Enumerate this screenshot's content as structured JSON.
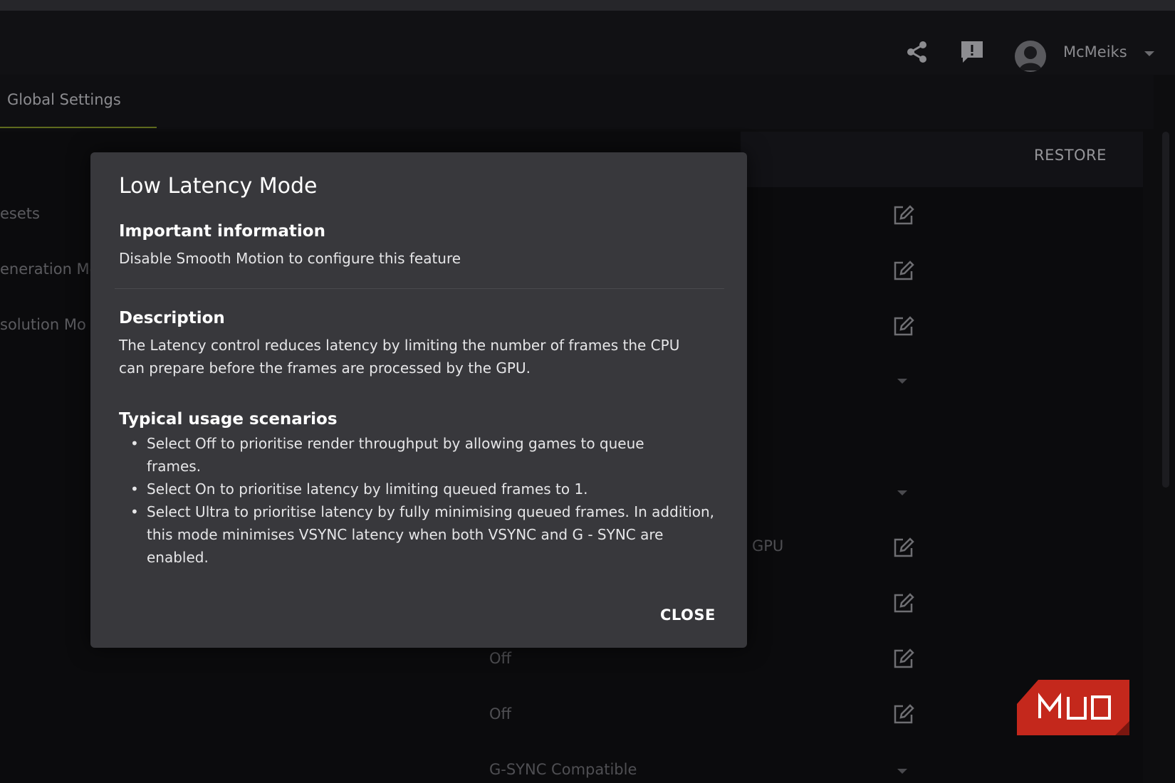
{
  "header": {
    "username": "McMeiks",
    "icons": {
      "share": "share-icon",
      "feedback": "feedback-icon",
      "avatar": "avatar",
      "menu": "chevron-down-icon"
    }
  },
  "tabs": {
    "global_settings": "Global Settings"
  },
  "toolbar": {
    "restore_label": "RESTORE"
  },
  "settings": {
    "left_labels": [
      "esets",
      "eneration Mo",
      "solution Mo"
    ],
    "gpu_label": "GPU",
    "values": [
      "Off",
      "Off",
      "G-SYNC Compatible"
    ]
  },
  "modal": {
    "title": "Low Latency Mode",
    "important_heading": "Important information",
    "important_text": "Disable Smooth Motion to configure this feature",
    "description_heading": "Description",
    "description_text": "The Latency control reduces latency by limiting the number of frames the CPU can prepare before the frames are processed by the GPU.",
    "usage_heading": "Typical usage scenarios",
    "usage_items": [
      "Select Off to prioritise render throughput by allowing games to queue frames.",
      "Select On to prioritise latency by limiting queued frames to 1.",
      "Select Ultra to prioritise latency by fully minimising queued frames. In addition, this mode minimises VSYNC latency when both VSYNC and G - SYNC are enabled."
    ],
    "close_label": "CLOSE"
  },
  "colors": {
    "accent": "#5e6a1e",
    "modal_bg": "#38383c",
    "watermark": "#c4281c"
  }
}
